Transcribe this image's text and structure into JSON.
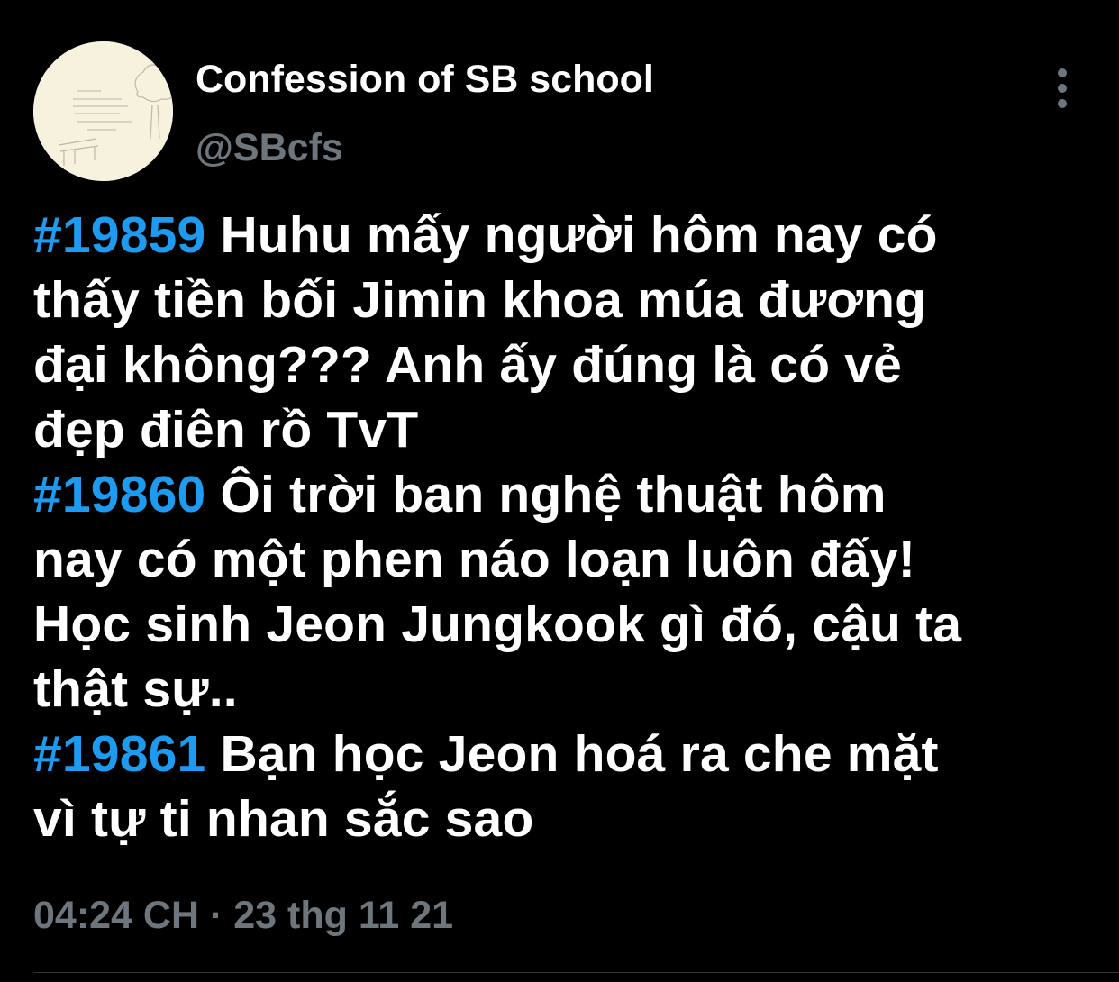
{
  "account": {
    "display_name": "Confession of SB school",
    "handle": "@SBcfs",
    "avatar_icon": "sketch-avatar-icon"
  },
  "menu": {
    "icon": "more-vertical-icon"
  },
  "tweet": {
    "lines": [
      {
        "hashtag": "#19859",
        "text": " Huhu mấy người hôm nay có"
      },
      {
        "hashtag": "",
        "text": "thấy tiền bối Jimin khoa múa đương"
      },
      {
        "hashtag": "",
        "text": "đại không??? Anh ấy đúng là có vẻ"
      },
      {
        "hashtag": "",
        "text": "đẹp điên rồ TvT"
      },
      {
        "hashtag": "#19860",
        "text": " Ôi trời ban nghệ thuật hôm"
      },
      {
        "hashtag": "",
        "text": "nay có một phen náo loạn luôn đấy!"
      },
      {
        "hashtag": "",
        "text": "Học sinh Jeon Jungkook gì đó, cậu ta"
      },
      {
        "hashtag": "",
        "text": "thật sự.."
      },
      {
        "hashtag": "#19861",
        "text": " Bạn học Jeon hoá ra che mặt"
      },
      {
        "hashtag": "",
        "text": "vì tự ti nhan sắc sao"
      }
    ]
  },
  "meta": {
    "timestamp": "04:24 CH · 23 thg 11 21"
  },
  "colors": {
    "background": "#000000",
    "text": "#ffffff",
    "hashtag": "#1d9bf0",
    "muted": "#6e767d",
    "avatar_bg": "#f6f2de"
  }
}
